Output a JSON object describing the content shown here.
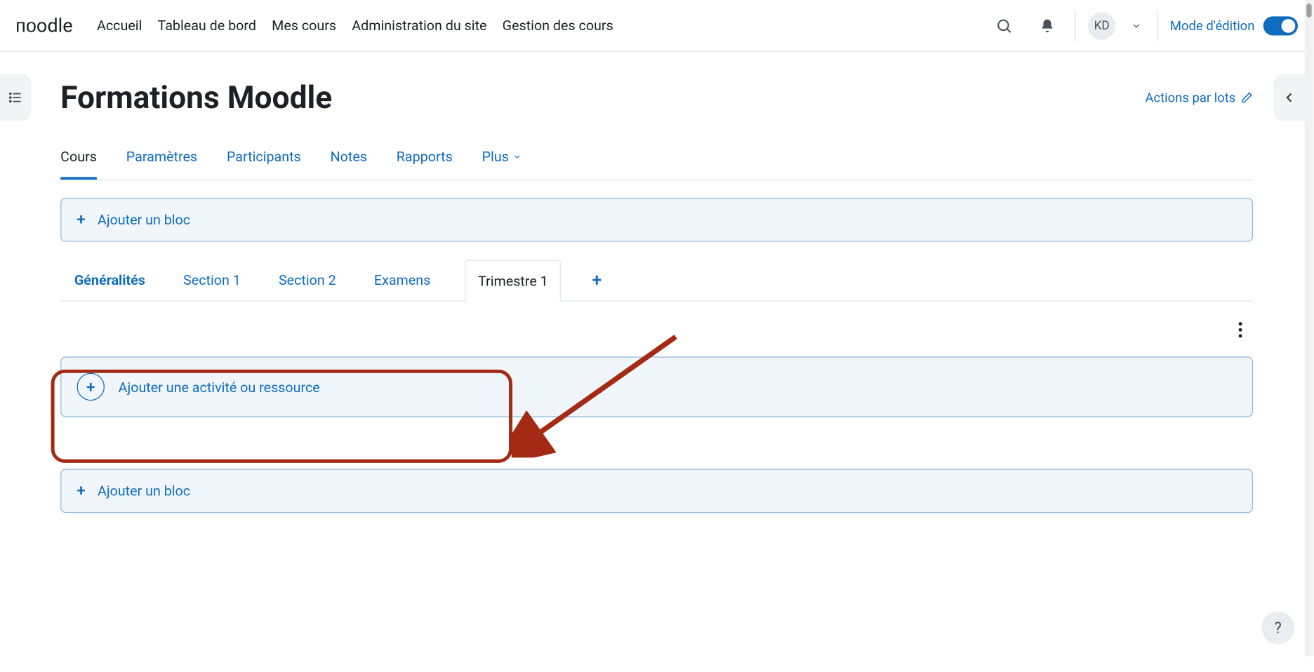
{
  "brand": "ᴨᴏodle",
  "nav": {
    "home": "Accueil",
    "dashboard": "Tableau de bord",
    "mycourses": "Mes cours",
    "siteadmin": "Administration du site",
    "coursemgmt": "Gestion des cours"
  },
  "user": {
    "initials": "KD"
  },
  "editmode_label": "Mode d'édition",
  "page_title": "Formations Moodle",
  "bulk_actions": "Actions par lots",
  "course_tabs": {
    "course": "Cours",
    "settings": "Paramètres",
    "participants": "Participants",
    "grades": "Notes",
    "reports": "Rapports",
    "more": "Plus"
  },
  "add_block_label": "Ajouter un bloc",
  "sub_tabs": {
    "general": "Généralités",
    "s1": "Section 1",
    "s2": "Section 2",
    "exams": "Examens",
    "t1": "Trimestre 1"
  },
  "add_activity_label": "Ajouter une activité ou ressource",
  "help_glyph": "?"
}
